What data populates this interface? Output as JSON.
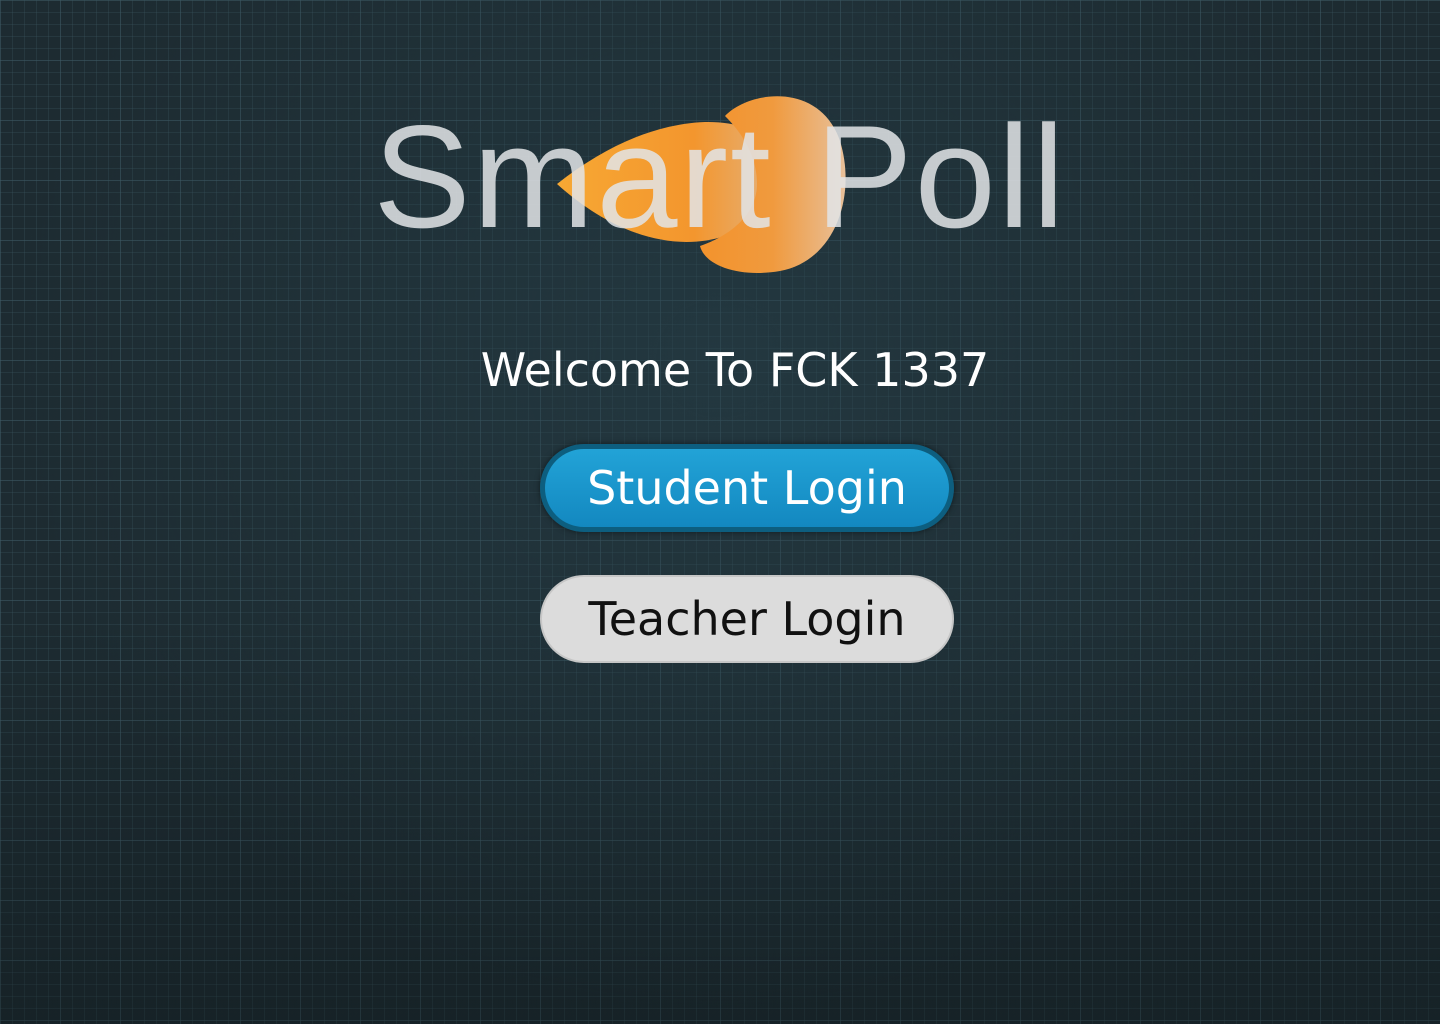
{
  "app": {
    "logo_text": "Smart Poll",
    "logo_mark_icon": "orange-fish-icon",
    "brand_colors": {
      "logo_orange": "#f39a2e",
      "logo_orange_light": "#e8b07a",
      "primary_button": "#1a98cf",
      "secondary_button": "#dcdcdc"
    }
  },
  "welcome": {
    "text": "Welcome To FCK 1337"
  },
  "buttons": {
    "student_label": "Student Login",
    "teacher_label": "Teacher Login"
  }
}
